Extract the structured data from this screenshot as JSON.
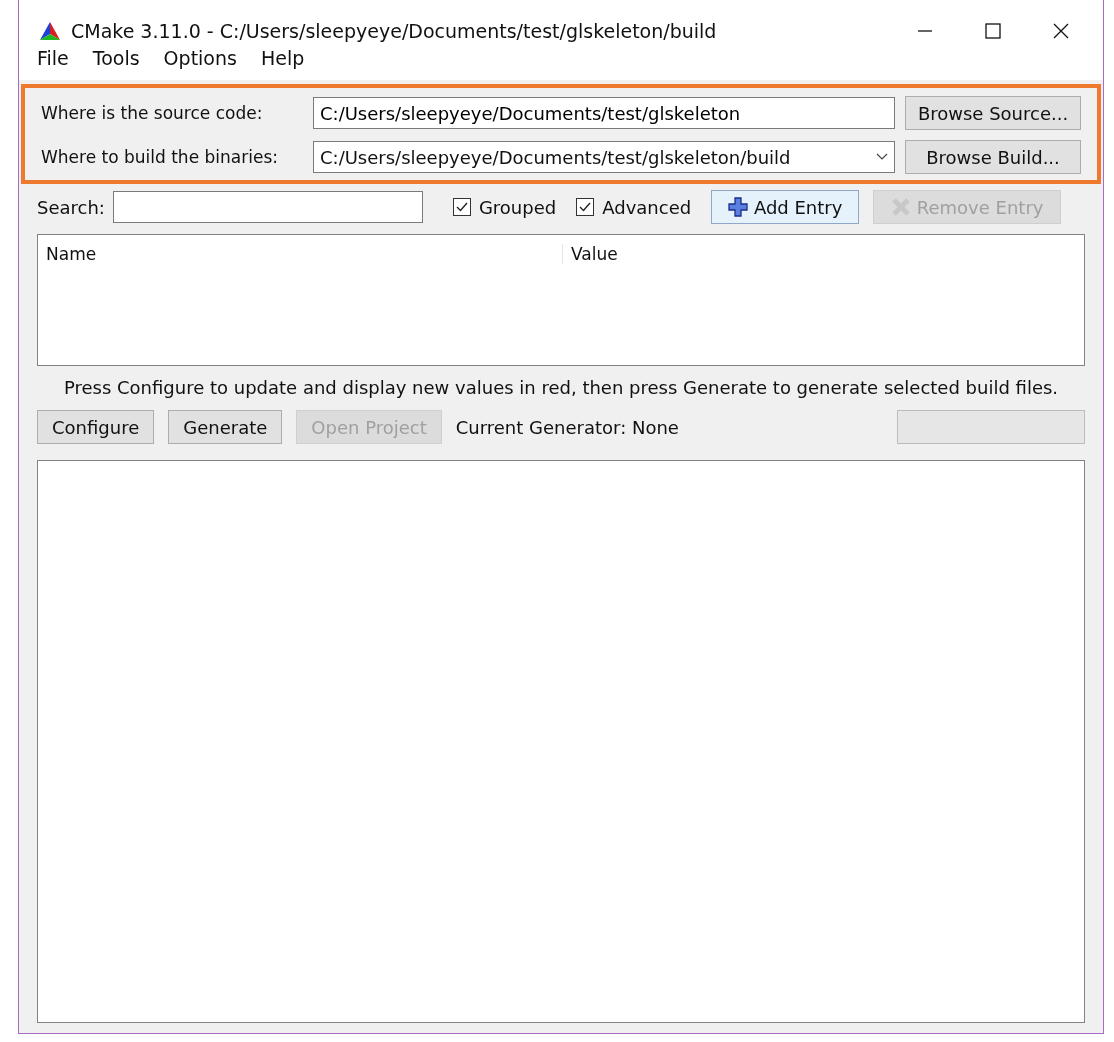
{
  "window": {
    "title": "CMake 3.11.0 - C:/Users/sleepyeye/Documents/test/glskeleton/build"
  },
  "menu": [
    "File",
    "Tools",
    "Options",
    "Help"
  ],
  "paths": {
    "highlighted": true,
    "source": {
      "label": "Where is the source code:",
      "value": "C:/Users/sleepyeye/Documents/test/glskeleton",
      "button": "Browse Source..."
    },
    "build": {
      "label": "Where to build the binaries:",
      "value": "C:/Users/sleepyeye/Documents/test/glskeleton/build",
      "button": "Browse Build..."
    }
  },
  "search": {
    "label": "Search:"
  },
  "options": [
    {
      "label": "Grouped",
      "checked": true
    },
    {
      "label": "Advanced",
      "checked": true
    }
  ],
  "entry_buttons": [
    {
      "label": "Add Entry",
      "kind": "add",
      "disabled": false
    },
    {
      "label": "Remove Entry",
      "kind": "remove",
      "disabled": true
    }
  ],
  "table": {
    "columns": [
      "Name",
      "Value"
    ]
  },
  "hint": "Press Configure to update and display new values in red, then press Generate to generate selected build files.",
  "actions": [
    {
      "label": "Configure",
      "disabled": false
    },
    {
      "label": "Generate",
      "disabled": false
    },
    {
      "label": "Open Project",
      "disabled": true
    }
  ],
  "generator": "Current Generator: None"
}
